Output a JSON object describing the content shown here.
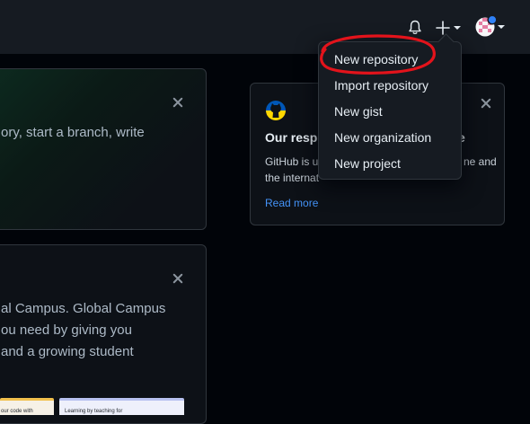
{
  "header": {
    "notifications_icon": "bell-icon",
    "create_icon": "plus-icon",
    "create_caret_icon": "caret-down-icon",
    "avatar_caret_icon": "caret-down-icon",
    "avatar_colors": {
      "base": "#e47ea3",
      "badge": "#2f81f7"
    }
  },
  "create_menu": {
    "items": [
      {
        "label": "New repository"
      },
      {
        "label": "Import repository"
      },
      {
        "label": "New gist"
      },
      {
        "label": "New organization"
      },
      {
        "label": "New project"
      }
    ],
    "highlight_color": "#e3131b"
  },
  "card_top": {
    "text_line": "ory, start a branch, write"
  },
  "card_campus": {
    "lines": [
      "al Campus. Global Campus",
      "ou need by giving you",
      "and a growing student"
    ],
    "thumbnails": [
      {
        "caption": "our code with"
      },
      {
        "caption": "Learning by teaching for"
      }
    ]
  },
  "announcement": {
    "logo_icon": "octocat-ukraine-icon",
    "title": "Our respo",
    "title_tail": "e",
    "line1_start": "GitHub is u",
    "line1_end": "ne and",
    "line2": "the internat",
    "read_more": "Read more",
    "colors": {
      "blue": "#0057b7",
      "yellow": "#ffd700",
      "link": "#4493f8"
    }
  }
}
